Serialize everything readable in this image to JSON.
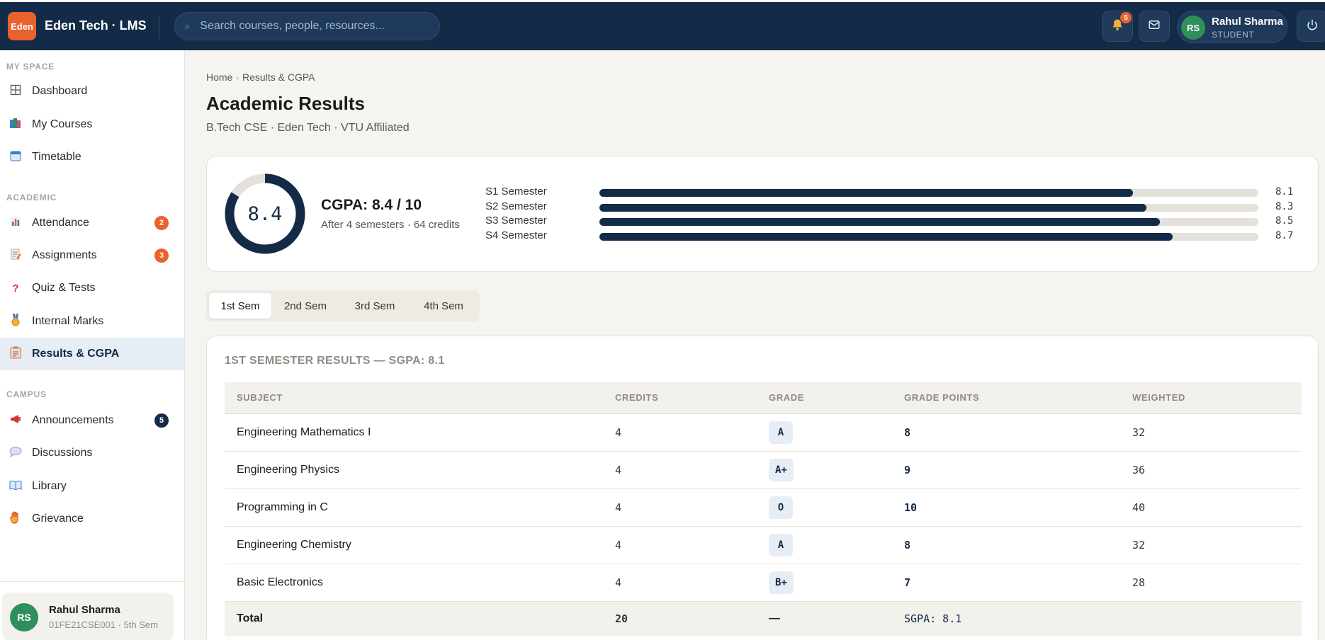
{
  "header": {
    "logo_text": "Eden",
    "app_title": "Eden Tech · LMS",
    "search_placeholder": "Search courses, people, resources...",
    "notification_count": "5",
    "user_initials": "RS",
    "user_name": "Rahul Sharma",
    "user_role": "STUDENT"
  },
  "sidebar": {
    "sections": [
      {
        "label": "MY SPACE"
      },
      {
        "label": "ACADEMIC"
      },
      {
        "label": "CAMPUS"
      }
    ],
    "items": [
      {
        "label": "Dashboard",
        "icon": "grid-icon"
      },
      {
        "label": "My Courses",
        "icon": "books-icon"
      },
      {
        "label": "Timetable",
        "icon": "calendar-icon"
      },
      {
        "label": "Attendance",
        "icon": "bar-chart-icon",
        "badge": "2"
      },
      {
        "label": "Assignments",
        "icon": "memo-icon",
        "badge": "3"
      },
      {
        "label": "Quiz & Tests",
        "icon": "question-icon"
      },
      {
        "label": "Internal Marks",
        "icon": "medal-icon"
      },
      {
        "label": "Results & CGPA",
        "icon": "clipboard-icon",
        "active": true
      },
      {
        "label": "Announcements",
        "icon": "megaphone-icon",
        "badge": "5"
      },
      {
        "label": "Discussions",
        "icon": "speech-bubble-icon"
      },
      {
        "label": "Library",
        "icon": "open-book-icon"
      },
      {
        "label": "Grievance",
        "icon": "raised-hand-icon"
      }
    ],
    "profile": {
      "initials": "RS",
      "name": "Rahul Sharma",
      "meta": "01FE21CSE001 · 5th Sem"
    }
  },
  "main": {
    "breadcrumb": [
      "Home",
      "Results & CGPA"
    ],
    "title": "Academic Results",
    "subtitle": "B.Tech CSE · Eden Tech · VTU Affiliated",
    "cgpa": {
      "ring_value": "8.4",
      "ring_fraction": 0.84,
      "title": "CGPA: 8.4 / 10",
      "subtitle": "After 4 semesters · 64 credits",
      "semesters": [
        {
          "label": "S1 Semester",
          "value": "8.1",
          "fraction": 0.81
        },
        {
          "label": "S2 Semester",
          "value": "8.3",
          "fraction": 0.83
        },
        {
          "label": "S3 Semester",
          "value": "8.5",
          "fraction": 0.85
        },
        {
          "label": "S4 Semester",
          "value": "8.7",
          "fraction": 0.87
        }
      ]
    },
    "tabs": [
      {
        "label": "1st Sem",
        "active": true
      },
      {
        "label": "2nd Sem"
      },
      {
        "label": "3rd Sem"
      },
      {
        "label": "4th Sem"
      }
    ],
    "results": {
      "title": "1ST SEMESTER RESULTS — SGPA: 8.1",
      "columns": [
        "SUBJECT",
        "CREDITS",
        "GRADE",
        "GRADE POINTS",
        "WEIGHTED"
      ],
      "rows": [
        {
          "subject": "Engineering Mathematics I",
          "credits": "4",
          "grade": "A",
          "points": "8",
          "weighted": "32"
        },
        {
          "subject": "Engineering Physics",
          "credits": "4",
          "grade": "A+",
          "points": "9",
          "weighted": "36"
        },
        {
          "subject": "Programming in C",
          "credits": "4",
          "grade": "O",
          "points": "10",
          "weighted": "40"
        },
        {
          "subject": "Engineering Chemistry",
          "credits": "4",
          "grade": "A",
          "points": "8",
          "weighted": "32"
        },
        {
          "subject": "Basic Electronics",
          "credits": "4",
          "grade": "B+",
          "points": "7",
          "weighted": "28"
        }
      ],
      "total": {
        "label": "Total",
        "credits": "20",
        "grade": "—",
        "points": "SGPA: 8.1"
      }
    }
  },
  "colors": {
    "navy": "#132b47",
    "accent_orange": "#e8622c",
    "avatar_green": "#2f8f5b"
  }
}
